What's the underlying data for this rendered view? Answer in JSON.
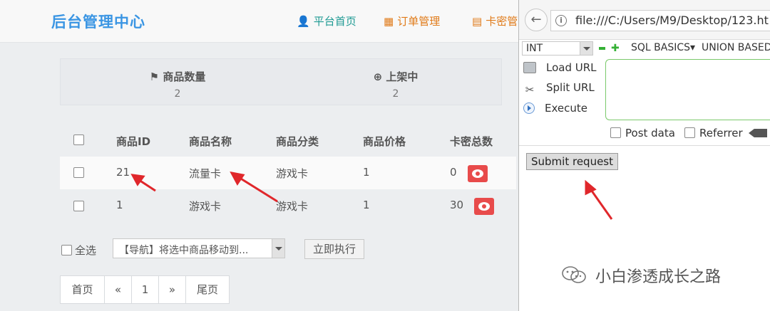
{
  "admin": {
    "brand": "后台管理中心",
    "nav": [
      {
        "icon": "user-icon",
        "label": "平台首页"
      },
      {
        "icon": "calendar-icon",
        "label": "订单管理"
      },
      {
        "icon": "list-icon",
        "label": "卡密管"
      }
    ],
    "stats": [
      {
        "icon": "flag-icon",
        "label": "商品数量",
        "value": "2"
      },
      {
        "icon": "plus-circle-icon",
        "label": "上架中",
        "value": "2"
      }
    ],
    "table": {
      "headers": [
        "商品ID",
        "商品名称",
        "商品分类",
        "商品价格",
        "卡密总数"
      ],
      "rows": [
        {
          "id": "21",
          "name": "流量卡",
          "category": "游戏卡",
          "price": "1",
          "total": "0"
        },
        {
          "id": "1",
          "name": "游戏卡",
          "category": "游戏卡",
          "price": "1",
          "total": "30"
        }
      ]
    },
    "bulk": {
      "select_all": "全选",
      "action_select": "【导航】将选中商品移动到...",
      "execute": "立即执行"
    },
    "pagination": [
      "首页",
      "«",
      "1",
      "»",
      "尾页"
    ]
  },
  "browser": {
    "url": "file:///C:/Users/M9/Desktop/123.ht",
    "hackbar": {
      "type_select": "INT",
      "menus": [
        "SQL BASICS▾",
        "UNION BASED"
      ],
      "actions": [
        "Load URL",
        "Split URL",
        "Execute"
      ],
      "post_data": "Post data",
      "referrer": "Referrer",
      "textarea_value": ""
    },
    "submit_button": "Submit request"
  },
  "watermark": "小白渗透成长之路",
  "colors": {
    "brand": "#3a95e3",
    "nav_home": "#1e9a93",
    "nav_orange": "#e07a18",
    "eye_button": "#e84b4b",
    "annotation_arrow": "#e0272b"
  }
}
